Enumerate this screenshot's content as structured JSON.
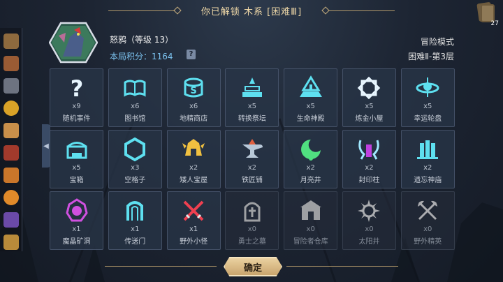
{
  "banner": {
    "title": "你已解锁 木系 [困难Ⅲ]"
  },
  "deck": {
    "count": "27"
  },
  "player": {
    "name": "怒鸦（等级 13）",
    "score": "本局积分：1164",
    "help": "?"
  },
  "run": {
    "mode": "冒险模式",
    "floor": "困难Ⅱ-第3层"
  },
  "sidebar": {
    "items": [
      "map-icon",
      "backpack-icon",
      "stone-icon",
      "coin-icon",
      "scroll-icon",
      "spellbook-icon",
      "wand-icon",
      "gem-icon",
      "card-icon",
      "anubis-icon"
    ],
    "collapse": "◀"
  },
  "tiles": [
    {
      "icon": "question-icon",
      "count": "x9",
      "name": "随机事件",
      "color": "#e8f6ff",
      "dim": false
    },
    {
      "icon": "book-icon",
      "count": "x6",
      "name": "图书馆",
      "color": "#5ee0f0",
      "dim": false
    },
    {
      "icon": "shop-icon",
      "count": "x6",
      "name": "地精商店",
      "color": "#5ee0f0",
      "dim": false
    },
    {
      "icon": "altar-icon",
      "count": "x5",
      "name": "转换祭坛",
      "color": "#5ee0f0",
      "dim": false
    },
    {
      "icon": "temple-icon",
      "count": "x5",
      "name": "生命神殿",
      "color": "#5ee0f0",
      "dim": false
    },
    {
      "icon": "alchemy-icon",
      "count": "x5",
      "name": "炼金小屋",
      "color": "#e8f6ff",
      "dim": false
    },
    {
      "icon": "roulette-icon",
      "count": "x5",
      "name": "幸运轮盘",
      "color": "#5ee0f0",
      "dim": false
    },
    {
      "icon": "chest-icon",
      "count": "x5",
      "name": "宝箱",
      "color": "#5ee0f0",
      "dim": false
    },
    {
      "icon": "hexagon-icon",
      "count": "x3",
      "name": "空格子",
      "color": "#5ee0f0",
      "dim": false
    },
    {
      "icon": "dwarf-treasure-icon",
      "count": "x2",
      "name": "矮人宝屋",
      "color": "#f0c040",
      "dim": false
    },
    {
      "icon": "anvil-icon",
      "count": "x2",
      "name": "铁匠铺",
      "color": "#e06040",
      "dim": false
    },
    {
      "icon": "moon-well-icon",
      "count": "x2",
      "name": "月亮井",
      "color": "#50e080",
      "dim": false
    },
    {
      "icon": "seal-pillar-icon",
      "count": "x2",
      "name": "封印柱",
      "color": "#a0e8ff",
      "dim": false
    },
    {
      "icon": "forgotten-temple-icon",
      "count": "x2",
      "name": "遗忘神庙",
      "color": "#5ee0f0",
      "dim": false
    },
    {
      "icon": "crystal-mine-icon",
      "count": "x1",
      "name": "魔晶矿洞",
      "color": "#d050e0",
      "dim": false
    },
    {
      "icon": "portal-icon",
      "count": "x1",
      "name": "传送门",
      "color": "#5ee0f0",
      "dim": false
    },
    {
      "icon": "crossed-swords-icon",
      "count": "x1",
      "name": "野外小怪",
      "color": "#f04050",
      "dim": false
    },
    {
      "icon": "tombstone-icon",
      "count": "x0",
      "name": "勇士之墓",
      "color": "#c8c8c8",
      "dim": true
    },
    {
      "icon": "warehouse-icon",
      "count": "x0",
      "name": "冒险者仓库",
      "color": "#c8c8c8",
      "dim": true
    },
    {
      "icon": "sun-well-icon",
      "count": "x0",
      "name": "太阳井",
      "color": "#d8d8d8",
      "dim": true
    },
    {
      "icon": "crossed-axes-icon",
      "count": "x0",
      "name": "野外精英",
      "color": "#d8d8d8",
      "dim": true
    }
  ],
  "confirm": {
    "label": "确定"
  }
}
